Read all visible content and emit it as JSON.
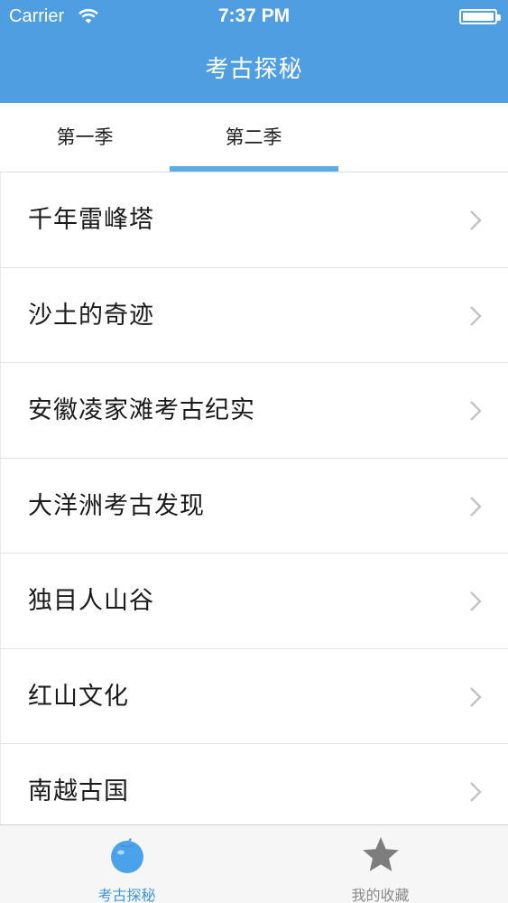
{
  "status_bar": {
    "carrier": "Carrier",
    "time": "7:37 PM"
  },
  "header": {
    "title": "考古探秘"
  },
  "tabs": [
    {
      "label": "第一季",
      "selected": false
    },
    {
      "label": "第二季",
      "selected": true
    }
  ],
  "list": {
    "items": [
      {
        "label": "千年雷峰塔"
      },
      {
        "label": "沙土的奇迹"
      },
      {
        "label": "安徽凌家滩考古纪实"
      },
      {
        "label": "大洋洲考古发现"
      },
      {
        "label": "独目人山谷"
      },
      {
        "label": "红山文化"
      },
      {
        "label": "南越古国"
      }
    ]
  },
  "tab_bar": {
    "items": [
      {
        "label": "考古探秘",
        "icon": "tomato-icon",
        "selected": true
      },
      {
        "label": "我的收藏",
        "icon": "star-icon",
        "selected": false
      }
    ]
  },
  "colors": {
    "accent": "#4f9ee1",
    "tab_indicator": "#5aaee8",
    "tab_selected_label": "#3f95df",
    "tab_unselected_label": "#8a8a8a"
  }
}
